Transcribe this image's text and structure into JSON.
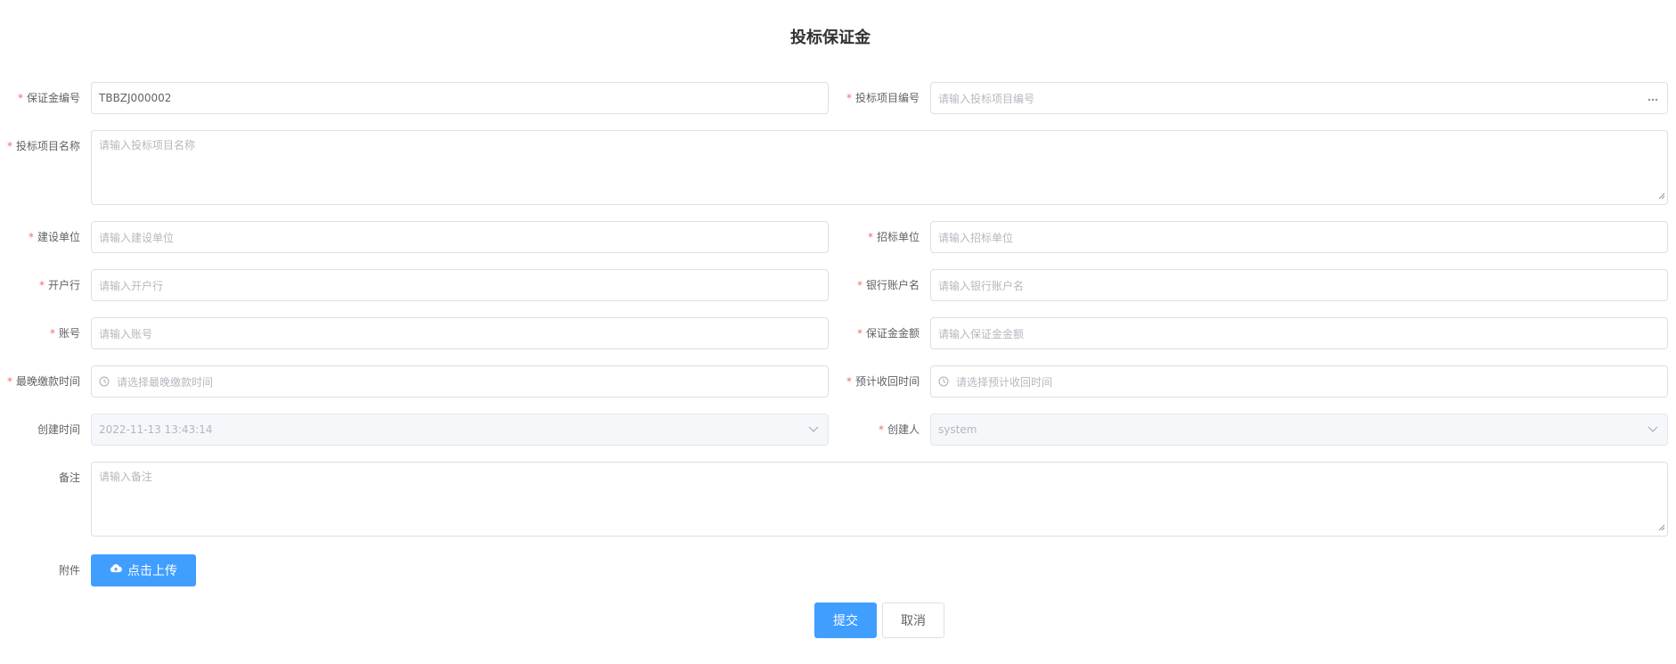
{
  "header": {
    "title": "投标保证金"
  },
  "form": {
    "bond_no": {
      "label": "保证金编号",
      "value": "TBBZJ000002"
    },
    "project_no": {
      "label": "投标项目编号",
      "placeholder": "请输入投标项目编号"
    },
    "project_name": {
      "label": "投标项目名称",
      "placeholder": "请输入投标项目名称"
    },
    "construction_unit": {
      "label": "建设单位",
      "placeholder": "请输入建设单位"
    },
    "tender_unit": {
      "label": "招标单位",
      "placeholder": "请输入招标单位"
    },
    "bank": {
      "label": "开户行",
      "placeholder": "请输入开户行"
    },
    "account_name": {
      "label": "银行账户名",
      "placeholder": "请输入银行账户名"
    },
    "account_no": {
      "label": "账号",
      "placeholder": "请输入账号"
    },
    "amount": {
      "label": "保证金金额",
      "placeholder": "请输入保证金金额"
    },
    "latest_payment_time": {
      "label": "最晚缴款时间",
      "placeholder": "请选择最晚缴款时间"
    },
    "expected_return_time": {
      "label": "预计收回时间",
      "placeholder": "请选择预计收回时间"
    },
    "created_time": {
      "label": "创建时间",
      "value": "2022-11-13 13:43:14"
    },
    "creator": {
      "label": "创建人",
      "value": "system"
    },
    "remark": {
      "label": "备注",
      "placeholder": "请输入备注"
    },
    "attachment": {
      "label": "附件",
      "upload_label": "点击上传"
    },
    "required_mark": "*"
  },
  "actions": {
    "submit_label": "提交",
    "cancel_label": "取消"
  },
  "colors": {
    "primary": "#409eff",
    "required": "#f56c6c",
    "border": "#dcdfe6"
  },
  "icons": {
    "more": "more-icon",
    "clock": "clock-icon",
    "chevron": "chevron-down-icon",
    "upload": "upload-cloud-icon",
    "resize": "resize-handle-icon"
  }
}
